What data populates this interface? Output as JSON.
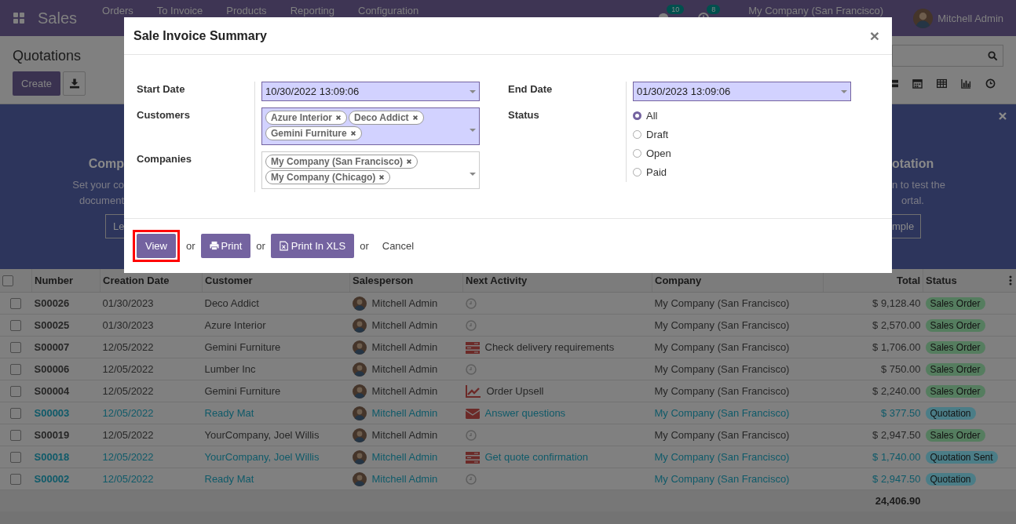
{
  "navbar": {
    "app": "Sales",
    "menu": [
      "Orders",
      "To Invoice",
      "Products",
      "Reporting",
      "Configuration"
    ],
    "messages_count": "10",
    "activities_count": "8",
    "company": "My Company (San Francisco)",
    "user": "Mitchell Admin"
  },
  "control_panel": {
    "title": "Quotations",
    "create": "Create"
  },
  "banner": {
    "left": [
      {
        "kind": "heading",
        "text": "Comp"
      },
      {
        "kind": "text",
        "text": "Set your co"
      },
      {
        "kind": "text",
        "text": "document"
      },
      {
        "kind": "button",
        "text": "Le"
      }
    ],
    "right": [
      {
        "kind": "heading",
        "text": "otation"
      },
      {
        "kind": "text",
        "text": "n to test the"
      },
      {
        "kind": "text",
        "text": "ortal."
      },
      {
        "kind": "button",
        "text": "mple"
      }
    ]
  },
  "table": {
    "select_all": {
      "checked": false
    },
    "columns": [
      "Number",
      "Creation Date",
      "Customer",
      "Salesperson",
      "Next Activity",
      "Company",
      "Total",
      "Status"
    ],
    "rows": [
      {
        "number": "S00026",
        "date": "01/30/2023",
        "customer": "Deco Addict",
        "salesperson": "Mitchell Admin",
        "activity": {
          "kind": "none"
        },
        "company": "My Company (San Francisco)",
        "total": "$ 9,128.40",
        "status": {
          "text": "Sales Order",
          "color": "#557d5f"
        },
        "info": false,
        "checked": false
      },
      {
        "number": "S00025",
        "date": "01/30/2023",
        "customer": "Azure Interior",
        "salesperson": "Mitchell Admin",
        "activity": {
          "kind": "none"
        },
        "company": "My Company (San Francisco)",
        "total": "$ 2,570.00",
        "status": {
          "text": "Sales Order",
          "color": "#557d5f"
        },
        "info": false,
        "checked": false
      },
      {
        "number": "S00007",
        "date": "12/05/2022",
        "customer": "Gemini Furniture",
        "salesperson": "Mitchell Admin",
        "activity": {
          "kind": "todo",
          "text": "Check delivery requirements"
        },
        "company": "My Company (San Francisco)",
        "total": "$ 1,706.00",
        "status": {
          "text": "Sales Order",
          "color": "#557d5f"
        },
        "info": false,
        "checked": false
      },
      {
        "number": "S00006",
        "date": "12/05/2022",
        "customer": "Lumber Inc",
        "salesperson": "Mitchell Admin",
        "activity": {
          "kind": "none"
        },
        "company": "My Company (San Francisco)",
        "total": "$ 750.00",
        "status": {
          "text": "Sales Order",
          "color": "#557d5f"
        },
        "info": false,
        "checked": false
      },
      {
        "number": "S00004",
        "date": "12/05/2022",
        "customer": "Gemini Furniture",
        "salesperson": "Mitchell Admin",
        "activity": {
          "kind": "upsell",
          "text": "Order Upsell"
        },
        "company": "My Company (San Francisco)",
        "total": "$ 2,240.00",
        "status": {
          "text": "Sales Order",
          "color": "#557d5f"
        },
        "info": false,
        "checked": false
      },
      {
        "number": "S00003",
        "date": "12/05/2022",
        "customer": "Ready Mat",
        "salesperson": "Mitchell Admin",
        "activity": {
          "kind": "email",
          "text": "Answer questions"
        },
        "company": "My Company (San Francisco)",
        "total": "$ 377.50",
        "status": {
          "text": "Quotation",
          "color": "#4b7d87"
        },
        "info": true,
        "checked": false
      },
      {
        "number": "S00019",
        "date": "12/05/2022",
        "customer": "YourCompany, Joel Willis",
        "salesperson": "Mitchell Admin",
        "activity": {
          "kind": "none"
        },
        "company": "My Company (San Francisco)",
        "total": "$ 2,947.50",
        "status": {
          "text": "Sales Order",
          "color": "#557d5f"
        },
        "info": false,
        "checked": false
      },
      {
        "number": "S00018",
        "date": "12/05/2022",
        "customer": "YourCompany, Joel Willis",
        "salesperson": "Mitchell Admin",
        "activity": {
          "kind": "todo",
          "text": "Get quote confirmation"
        },
        "company": "My Company (San Francisco)",
        "total": "$ 1,740.00",
        "status": {
          "text": "Quotation Sent",
          "color": "#4b7d87"
        },
        "info": true,
        "checked": false
      },
      {
        "number": "S00002",
        "date": "12/05/2022",
        "customer": "Ready Mat",
        "salesperson": "Mitchell Admin",
        "activity": {
          "kind": "none"
        },
        "company": "My Company (San Francisco)",
        "total": "$ 2,947.50",
        "status": {
          "text": "Quotation",
          "color": "#4b7d87"
        },
        "info": true,
        "checked": false
      }
    ],
    "total": "24,406.90"
  },
  "dialog": {
    "title": "Sale Invoice Summary",
    "close": "×",
    "start_date": {
      "label": "Start Date",
      "value": "10/30/2022 13:09:06",
      "required": true
    },
    "customers": {
      "label": "Customers",
      "tags": [
        "Azure Interior",
        "Deco Addict",
        "Gemini Furniture"
      ],
      "required": true
    },
    "companies": {
      "label": "Companies",
      "tags": [
        "My Company (San Francisco)",
        "My Company (Chicago)"
      ],
      "required": false
    },
    "end_date": {
      "label": "End Date",
      "value": "01/30/2023 13:09:06",
      "required": true
    },
    "status": {
      "label": "Status",
      "options": [
        {
          "label": "All",
          "selected": true
        },
        {
          "label": "Draft",
          "selected": false
        },
        {
          "label": "Open",
          "selected": false
        },
        {
          "label": "Paid",
          "selected": false
        }
      ]
    },
    "footer": [
      {
        "kind": "button",
        "label": "View",
        "highlighted": true
      },
      {
        "kind": "or",
        "label": "or"
      },
      {
        "kind": "print",
        "label": "Print",
        "highlighted": false
      },
      {
        "kind": "or",
        "label": "or"
      },
      {
        "kind": "export",
        "label": "Print In XLS",
        "highlighted": false
      },
      {
        "kind": "or",
        "label": "or"
      },
      {
        "kind": "link",
        "label": "Cancel"
      }
    ]
  }
}
